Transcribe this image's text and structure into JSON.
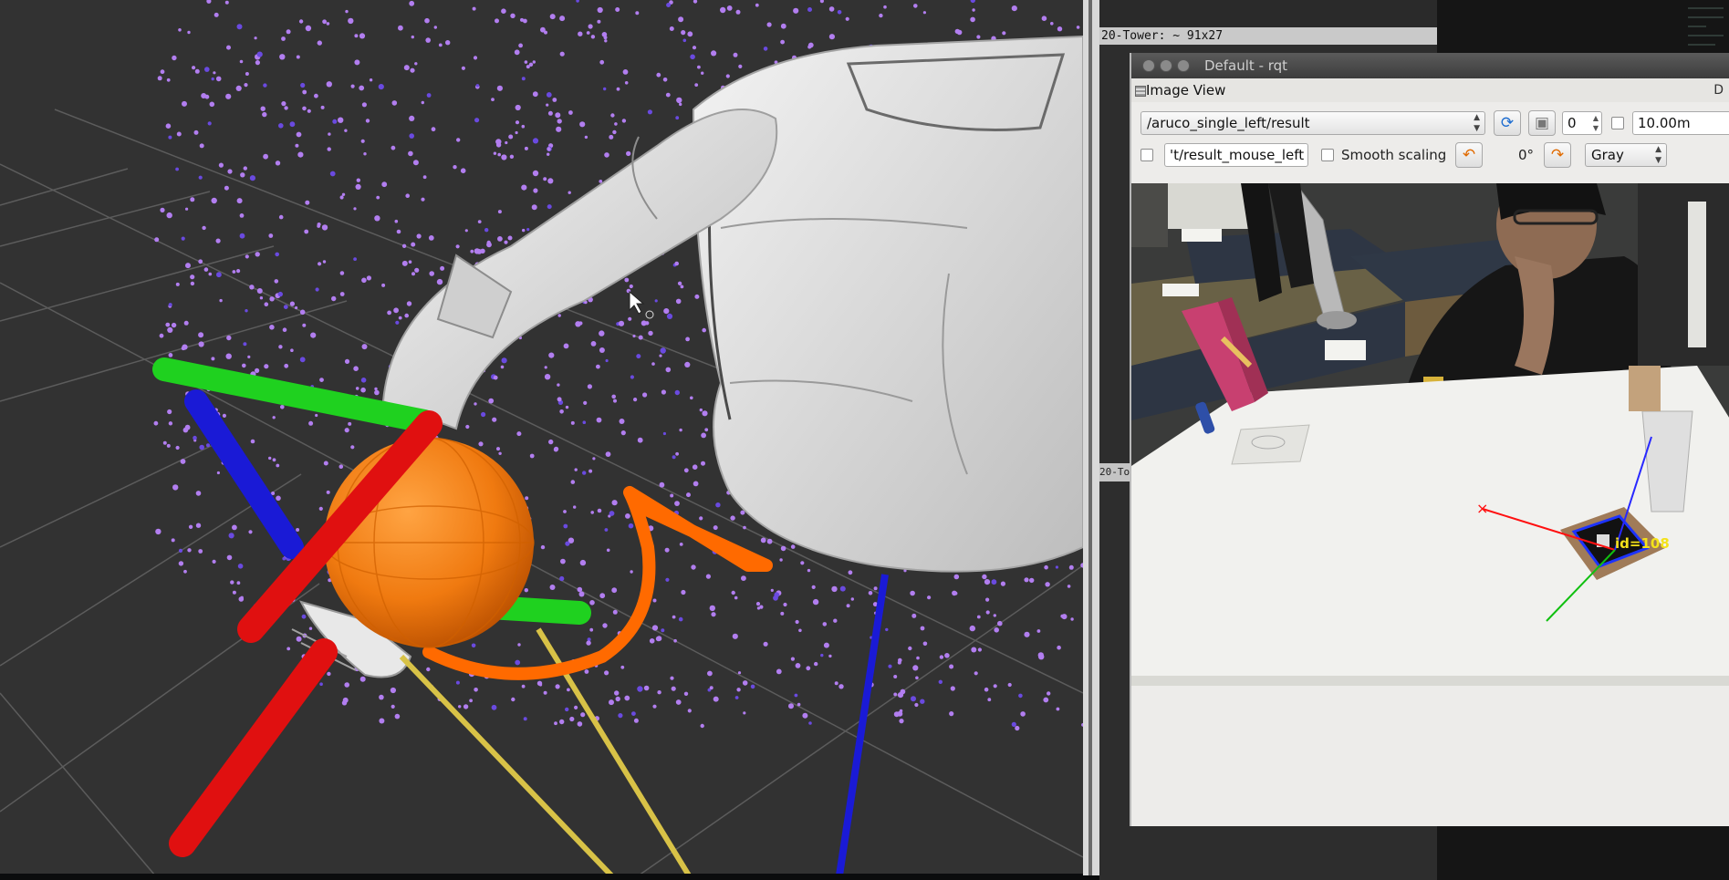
{
  "background_terminal": {
    "title": "20-Tower: ~ 91x27",
    "side_label": "20-To"
  },
  "rqt": {
    "window_title": "Default - rqt",
    "panel_title": "Image View",
    "dock_button": "D",
    "topic": "/aruco_single_left/result",
    "number_value": "0",
    "max_depth": "10.00m",
    "mouse_topic": "'t/result_mouse_left",
    "smooth_scaling_label": "Smooth scaling",
    "smooth_scaling_checked": false,
    "rotation": "0°",
    "color_scheme": "Gray",
    "image_overlay": {
      "marker_label": "id=108"
    }
  },
  "colors": {
    "point_cloud": "#b27ef0",
    "axis_red": "#e01010",
    "axis_green": "#1fd11f",
    "axis_blue": "#1a1ad6",
    "sphere": "#f07a10",
    "trajectory": "#ff6a00",
    "grid_line": "#5a5a5a",
    "ray_yellow": "#d8c247"
  }
}
